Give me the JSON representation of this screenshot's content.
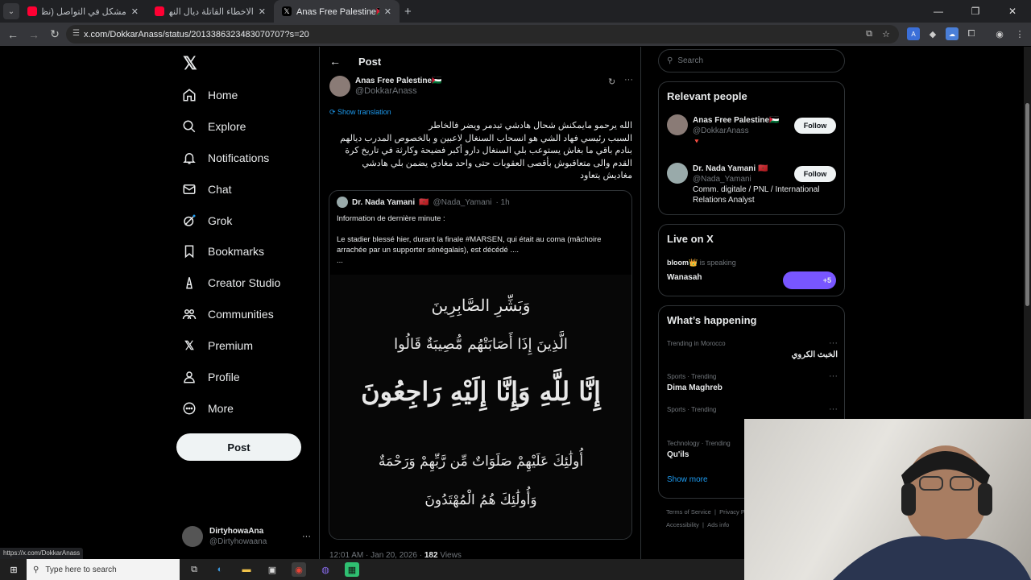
{
  "browser": {
    "tabs": [
      {
        "title": "مشكل في التواصل (نظرية البراكَ...",
        "favicon_color": "#ff0033",
        "active": false
      },
      {
        "title": "الاخطاء القاتلة ديال النهائي! واش...",
        "favicon_color": "#ff0033",
        "active": false
      },
      {
        "title": "Anas Free Palestine🇵🇸 on X: \"الله...",
        "favicon_color": "#000000",
        "active": true
      }
    ],
    "url": "x.com/DokkarAnass/status/2013386323483070707?s=20",
    "status_url": "https://x.com/DokkarAnass"
  },
  "sidebar": {
    "logo": "𝕏",
    "items": [
      {
        "label": "Home",
        "icon": "home-icon",
        "glyph": "⌂"
      },
      {
        "label": "Explore",
        "icon": "search-icon",
        "glyph": "⚲"
      },
      {
        "label": "Notifications",
        "icon": "bell-icon",
        "glyph": "🔔"
      },
      {
        "label": "Chat",
        "icon": "mail-icon",
        "glyph": "✉"
      },
      {
        "label": "Grok",
        "icon": "grok-icon",
        "glyph": "◎"
      },
      {
        "label": "Bookmarks",
        "icon": "bookmark-icon",
        "glyph": "▯"
      },
      {
        "label": "Creator Studio",
        "icon": "creator-icon",
        "glyph": "♙"
      },
      {
        "label": "Communities",
        "icon": "communities-icon",
        "glyph": "⚇"
      },
      {
        "label": "Premium",
        "icon": "x-premium-icon",
        "glyph": "𝕏"
      },
      {
        "label": "Profile",
        "icon": "profile-icon",
        "glyph": "⚲"
      },
      {
        "label": "More",
        "icon": "more-circle-icon",
        "glyph": "⋯"
      }
    ],
    "post_button": "Post",
    "account": {
      "name": "DirtyhowaAna",
      "handle": "@Dirtyhowaana",
      "more": "···"
    }
  },
  "post": {
    "header": "Post",
    "back": "←",
    "author_name": "Anas Free Palestine🇵🇸",
    "author_handle": "@DokkarAnass",
    "show_translation": "Show translation",
    "text": "الله يرحمو مايمكنش شحال هادشي تيدمر ويضر فالخاطر\nالسبب رئيسي فهاد الشي هو انسحاب السنغال لاعبين و بالخصوص المدرب ديالهم بنادم باقي ما بغاش يستوعب بلي السنغال دارو أكبر فضيحة وكارثة في تاريخ كرة القدم والى متعاقبوش بأقصى العقوبات حتى واحد مغادي يضمن بلي هادشي مغاديش يتعاود",
    "quote": {
      "name": "Dr. Nada Yamani",
      "flag": "🇲🇦",
      "handle": "@Nada_Yamani",
      "time": "· 1h",
      "text": "Information de dernière minute :\n\nLe stadier blessé hier, durant la finale #MARSEN, qui était au coma (mâchoire arrachée par un supporter sénégalais), est décédé ....\n...",
      "image_lines": [
        "وَبَشِّرِ الصَّابِرِينَ",
        "الَّذِينَ إِذَا أَصَابَتْهُم مُّصِيبَةٌ قَالُوا",
        "إِنَّا لِلَّهِ وَإِنَّا إِلَيْهِ رَاجِعُونَ",
        "أُولَٰئِكَ عَلَيْهِمْ صَلَوَاتٌ مِّن رَّبِّهِمْ وَرَحْمَةٌ",
        "وَأُولَٰئِكَ هُمُ الْمُهْتَدُونَ"
      ]
    },
    "timestamp": "12:01 AM · Jan 20, 2026 · ",
    "views_count": "182",
    "views_label": " Views"
  },
  "right": {
    "search_placeholder": "Search",
    "relevant_title": "Relevant people",
    "people": [
      {
        "name": "Anas Free Palestine🇵🇸",
        "handle": "@DokkarAnass",
        "bio": "🔻",
        "follow": "Follow"
      },
      {
        "name": "Dr. Nada Yamani 🇲🇦",
        "handle": "@Nada_Yamani",
        "bio": "Comm. digitale / PNL / International Relations Analyst",
        "follow": "Follow"
      }
    ],
    "live_title": "Live on X",
    "live": {
      "host": "bloom👑",
      "status": "is speaking",
      "title": "Wanasah",
      "count": "+5"
    },
    "happening_title": "What’s happening",
    "trends": [
      {
        "context": "Trending in Morocco",
        "name": "الخبث الكروي",
        "rtl": true
      },
      {
        "context": "Sports · Trending",
        "name": "Dima Maghreb",
        "rtl": false
      },
      {
        "context": "Sports · Trending",
        "name": "",
        "rtl": false
      },
      {
        "context": "Technology · Trending",
        "name": "Qu'ils",
        "rtl": false
      }
    ],
    "show_more": "Show more",
    "footer": [
      "Terms of Service",
      "Privacy P",
      "Accessibility",
      "Ads info"
    ]
  },
  "taskbar": {
    "search_placeholder": "Type here to search"
  },
  "colors": {
    "accent": "#1d9bf0",
    "bg": "#000000",
    "border": "#2f3336"
  }
}
